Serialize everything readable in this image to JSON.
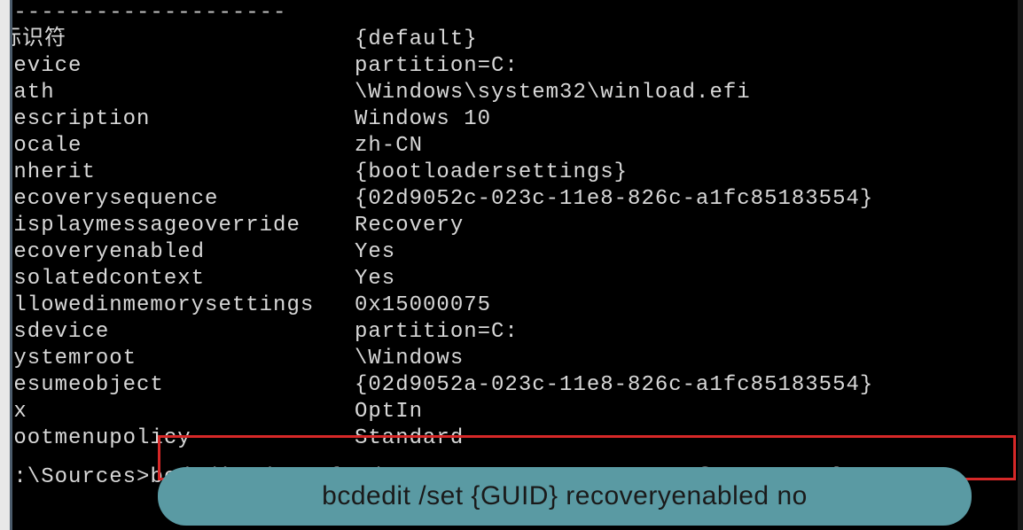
{
  "terminal": {
    "divider": "---------------------",
    "entries": [
      {
        "label": "标识符",
        "value": "{default}"
      },
      {
        "label": "device",
        "value": "partition=C:"
      },
      {
        "label": "path",
        "value": "\\Windows\\system32\\winload.efi"
      },
      {
        "label": "description",
        "value": "Windows 10"
      },
      {
        "label": "locale",
        "value": "zh-CN"
      },
      {
        "label": "inherit",
        "value": "{bootloadersettings}"
      },
      {
        "label": "recoverysequence",
        "value": "{02d9052c-023c-11e8-826c-a1fc85183554}"
      },
      {
        "label": "displaymessageoverride",
        "value": "Recovery"
      },
      {
        "label": "recoveryenabled",
        "value": "Yes"
      },
      {
        "label": "isolatedcontext",
        "value": "Yes"
      },
      {
        "label": "allowedinmemorysettings",
        "value": "0x15000075"
      },
      {
        "label": "osdevice",
        "value": "partition=C:"
      },
      {
        "label": "systemroot",
        "value": "\\Windows"
      },
      {
        "label": "resumeobject",
        "value": "{02d9052a-023c-11e8-826c-a1fc85183554}"
      },
      {
        "label": "nx",
        "value": "OptIn"
      },
      {
        "label": "bootmenupolicy",
        "value": "Standard"
      }
    ],
    "prompt_path": "X:\\Sources>",
    "prompt_command": "bcdedit /set {02d9052a-023c-11e8-826c-a1fc85183554} rec"
  },
  "annotation": {
    "text": "bcdedit /set {GUID} recoveryenabled no"
  }
}
